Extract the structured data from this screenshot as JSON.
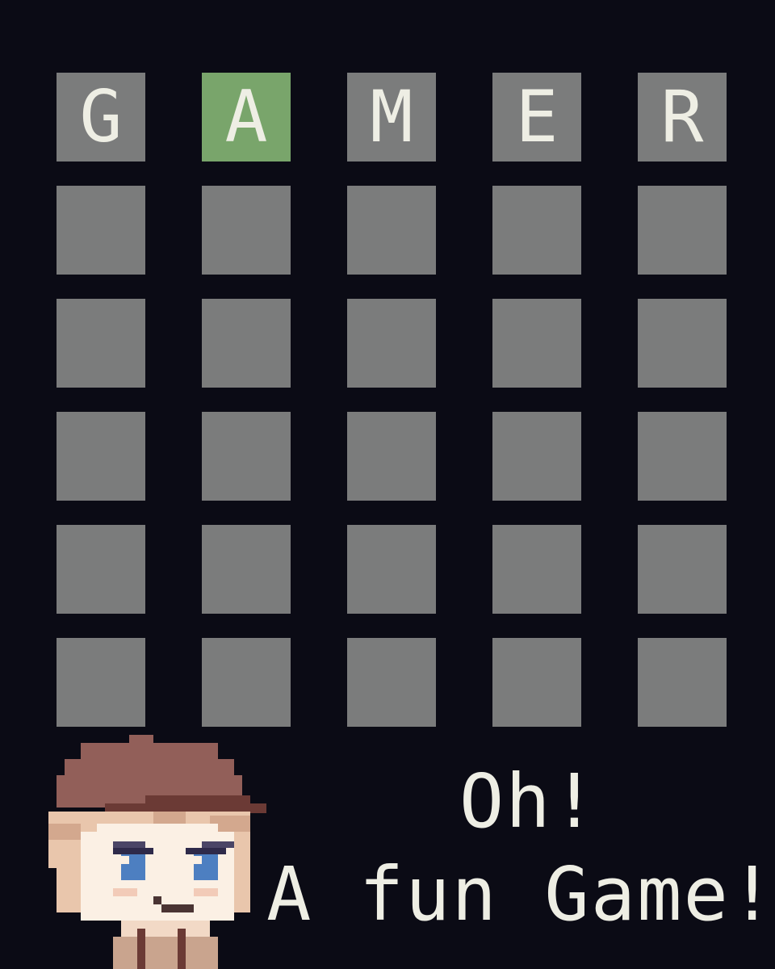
{
  "board": {
    "rows": [
      [
        {
          "letter": "G",
          "state": "absent"
        },
        {
          "letter": "A",
          "state": "correct"
        },
        {
          "letter": "M",
          "state": "absent"
        },
        {
          "letter": "E",
          "state": "absent"
        },
        {
          "letter": "R",
          "state": "absent"
        }
      ],
      [
        {
          "letter": "",
          "state": "empty"
        },
        {
          "letter": "",
          "state": "empty"
        },
        {
          "letter": "",
          "state": "empty"
        },
        {
          "letter": "",
          "state": "empty"
        },
        {
          "letter": "",
          "state": "empty"
        }
      ],
      [
        {
          "letter": "",
          "state": "empty"
        },
        {
          "letter": "",
          "state": "empty"
        },
        {
          "letter": "",
          "state": "empty"
        },
        {
          "letter": "",
          "state": "empty"
        },
        {
          "letter": "",
          "state": "empty"
        }
      ],
      [
        {
          "letter": "",
          "state": "empty"
        },
        {
          "letter": "",
          "state": "empty"
        },
        {
          "letter": "",
          "state": "empty"
        },
        {
          "letter": "",
          "state": "empty"
        },
        {
          "letter": "",
          "state": "empty"
        }
      ],
      [
        {
          "letter": "",
          "state": "empty"
        },
        {
          "letter": "",
          "state": "empty"
        },
        {
          "letter": "",
          "state": "empty"
        },
        {
          "letter": "",
          "state": "empty"
        },
        {
          "letter": "",
          "state": "empty"
        }
      ],
      [
        {
          "letter": "",
          "state": "empty"
        },
        {
          "letter": "",
          "state": "empty"
        },
        {
          "letter": "",
          "state": "empty"
        },
        {
          "letter": "",
          "state": "empty"
        },
        {
          "letter": "",
          "state": "empty"
        }
      ]
    ]
  },
  "dialog": {
    "line1": "Oh!",
    "line2": "A fun Game!"
  },
  "character": {
    "icon": "character-portrait-icon"
  },
  "colors": {
    "background": "#0b0b15",
    "tile_empty": "#7b7c7c",
    "tile_correct": "#79a56b",
    "letter": "#eeeee4",
    "hat": "#925f59",
    "hat_band": "#6b3a35",
    "hair": "#e9c6ac",
    "skin": "#fbf0e4",
    "eyes": "#4d7fc1"
  }
}
